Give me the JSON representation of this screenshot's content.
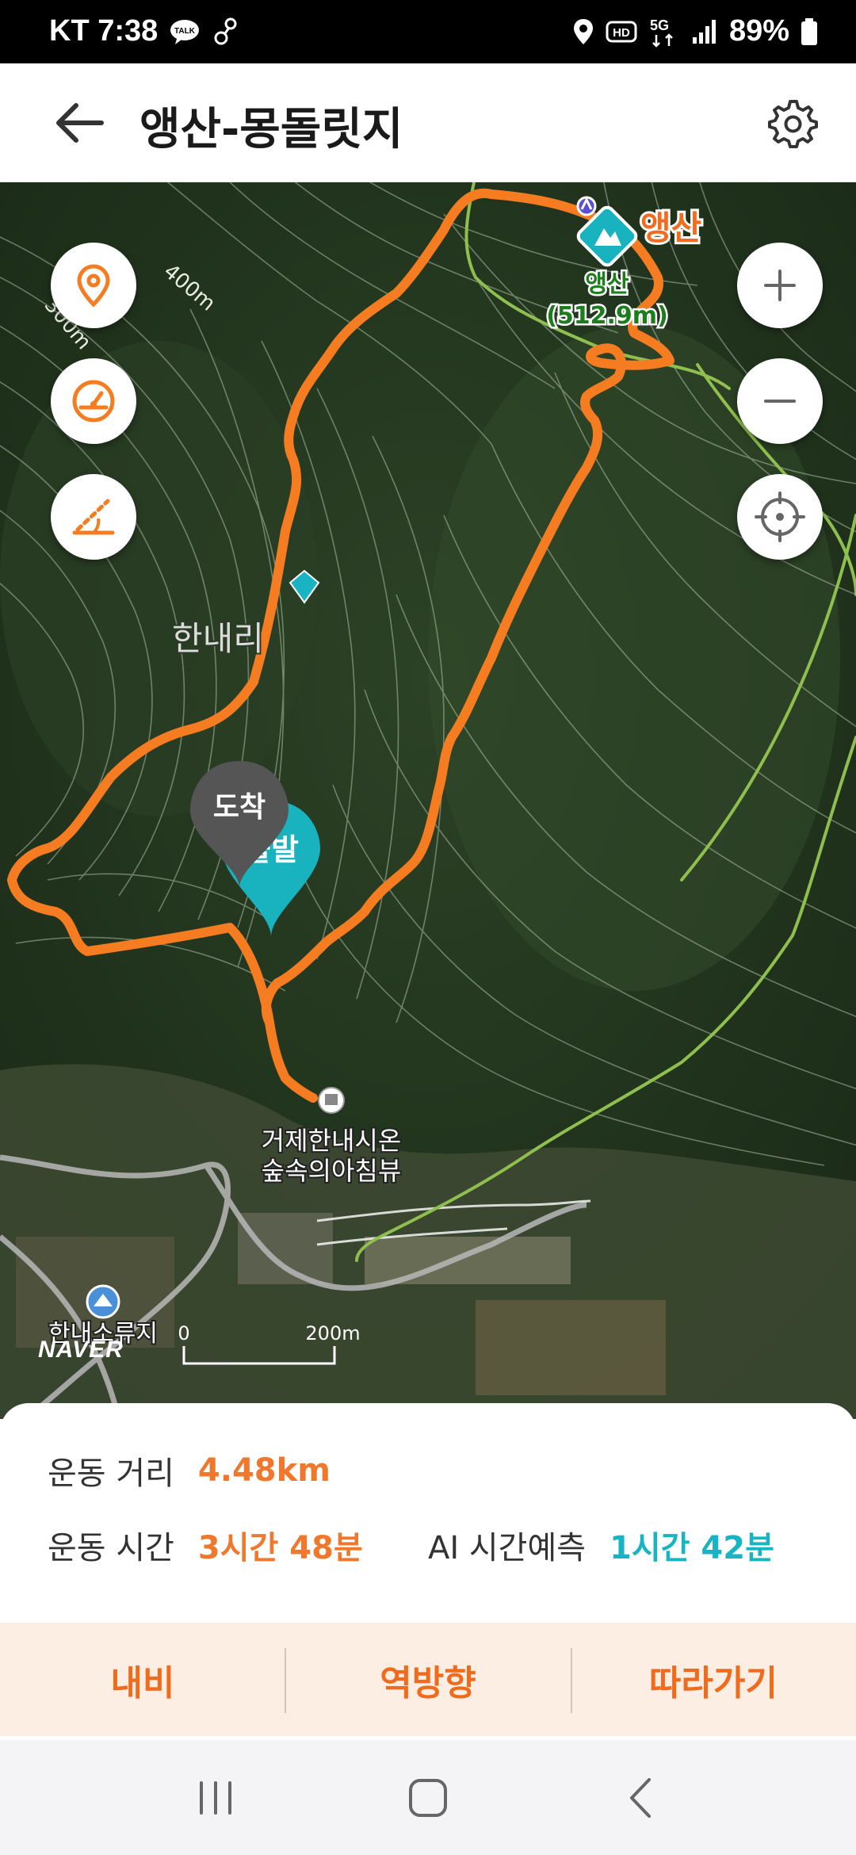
{
  "status_bar": {
    "carrier_time": "KT 7:38",
    "network": "5G",
    "battery": "89%",
    "icons": [
      "talk-icon",
      "walk-icon",
      "location-icon",
      "hd-icon",
      "signal-icon",
      "battery-icon"
    ]
  },
  "header": {
    "title": "앵산-몽돌릿지",
    "back_icon": "arrow-left-icon",
    "settings_icon": "gear-icon"
  },
  "map": {
    "contour_labels": [
      "400m",
      "300m"
    ],
    "summit": {
      "name": "앵산",
      "label_line1": "앵산",
      "label_line2": "(512.9m)"
    },
    "village": "한내리",
    "markers": {
      "arrival": "도착",
      "departure": "출발"
    },
    "poi": {
      "line1": "거제한내시온",
      "line2": "숲속의아침뷰"
    },
    "reservoir": "한내소류지",
    "scale": {
      "start": "0",
      "end": "200m"
    },
    "logo": "NAVER",
    "left_controls": [
      "pin-icon",
      "speedometer-icon",
      "slope-icon"
    ],
    "right_controls": [
      "zoom-in-icon",
      "zoom-out-icon",
      "crosshair-icon"
    ],
    "colors": {
      "route": "#f57c21",
      "trail": "#8fbf4e",
      "teal": "#19b3bf"
    }
  },
  "info": {
    "distance_label": "운동 거리",
    "distance_value": "4.48km",
    "time_label": "운동 시간",
    "time_value": "3시간 48분",
    "ai_label": "AI 시간예측",
    "ai_value": "1시간 42분"
  },
  "actions": {
    "nav_label": "내비",
    "reverse_label": "역방향",
    "follow_label": "따라가기"
  },
  "nav_bar": {
    "icons": [
      "recent-apps-icon",
      "home-icon",
      "back-icon"
    ]
  }
}
